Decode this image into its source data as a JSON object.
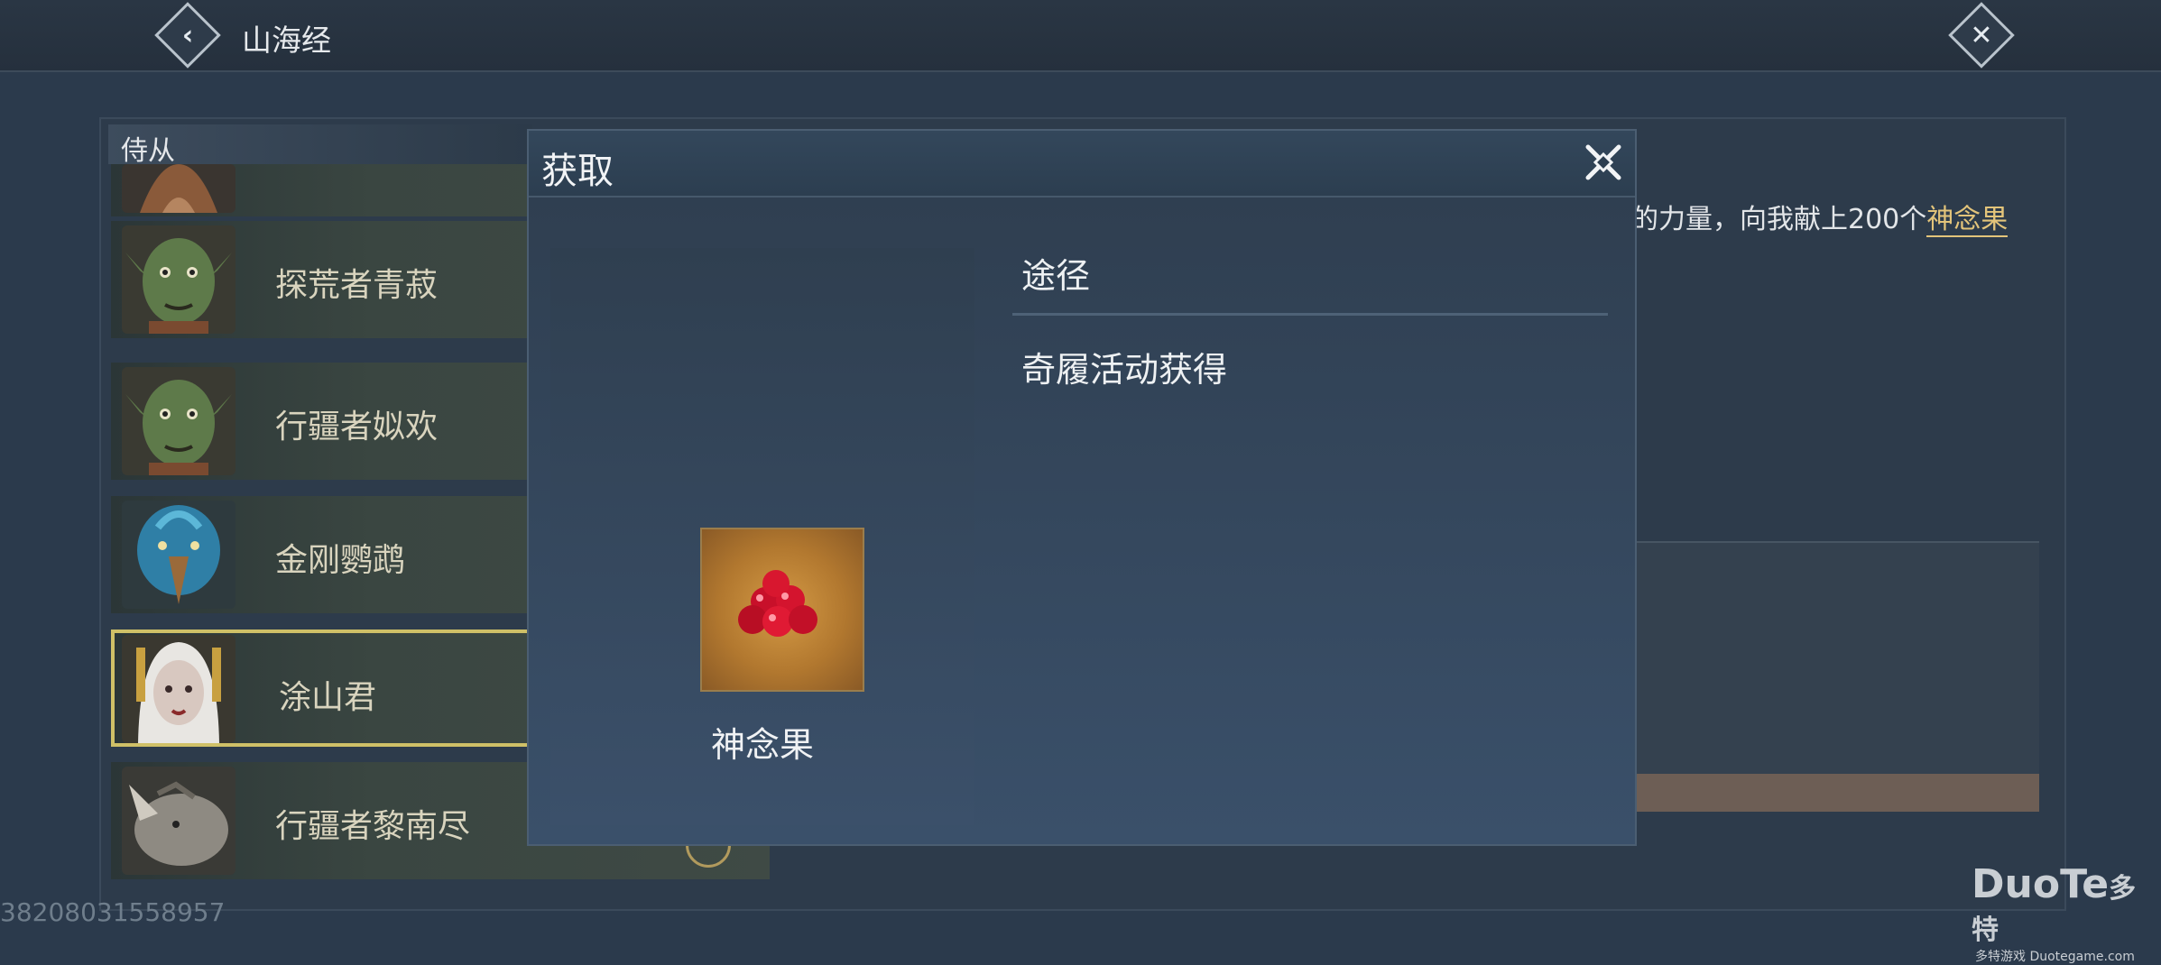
{
  "header": {
    "title": "山海经",
    "back_icon": "back-arrow-icon",
    "close_icon": "close-x-icon"
  },
  "sidebar": {
    "title": "侍从",
    "items": [
      {
        "label": "探荒者青菽",
        "avatar": "goblin-portrait"
      },
      {
        "label": "行疆者姒欢",
        "avatar": "goblin-portrait"
      },
      {
        "label": "金刚鹦鹉",
        "avatar": "parrot-portrait"
      },
      {
        "label": "涂山君",
        "avatar": "white-haired-woman-portrait",
        "selected": true
      },
      {
        "label": "行疆者黎南尽",
        "avatar": "rhino-portrait"
      }
    ]
  },
  "background_panel": {
    "quest_text": "的力量，向我献上200个",
    "quest_highlight": "神念果"
  },
  "modal": {
    "title": "获取",
    "item_name": "神念果",
    "source_heading": "途径",
    "sources": [
      "奇履活动获得"
    ]
  },
  "footer": {
    "player_id": "38208031558957",
    "watermark_main": "DuoTe",
    "watermark_cn": "多特",
    "watermark_sub": "多特游戏 Duotegame.com"
  },
  "colors": {
    "highlight": "#e3c47a",
    "selected_border": "#cfc067",
    "modal_bg": "#33475b"
  }
}
